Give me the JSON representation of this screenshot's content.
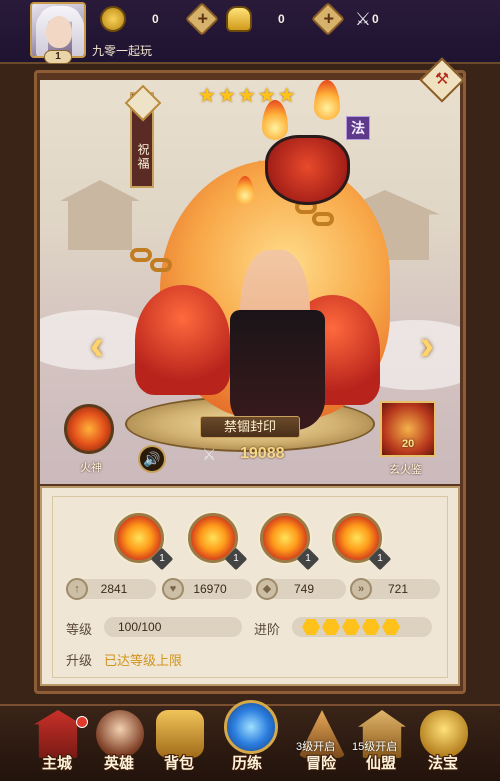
{
  "player": {
    "name": "九零一起玩",
    "level": "1"
  },
  "resources": [
    {
      "icon": "coin-icon",
      "value": "0"
    },
    {
      "icon": "gold-ingot-icon",
      "value": "0"
    },
    {
      "icon": "crossed-swords-icon",
      "value": "0"
    }
  ],
  "hero": {
    "stars": 5,
    "star_char": "★",
    "class_badge": "法",
    "bless_label": "祝福",
    "seal_label": "禁锢封印",
    "power": "19088",
    "fire_god_label": "火神",
    "artifact_label": "玄火鉴",
    "artifact_level": "20",
    "nav_prev": "‹",
    "nav_next": "›"
  },
  "skills": [
    {
      "name": "skill-1",
      "level": "1"
    },
    {
      "name": "skill-2",
      "level": "1"
    },
    {
      "name": "skill-3",
      "level": "1"
    },
    {
      "name": "skill-4",
      "level": "1"
    }
  ],
  "stats": [
    {
      "icon": "attack-icon",
      "value": "2841"
    },
    {
      "icon": "heart-icon",
      "value": "16970"
    },
    {
      "icon": "shield-icon",
      "value": "749"
    },
    {
      "icon": "speed-icon",
      "value": "721"
    }
  ],
  "level_row": {
    "label": "等级",
    "value": "100/100"
  },
  "advance_row": {
    "label": "进阶",
    "filled": 5,
    "total": 5
  },
  "upgrade_row": {
    "label": "升级",
    "status": "已达等级上限"
  },
  "nav": [
    {
      "label": "主城",
      "lock": "",
      "badge": true
    },
    {
      "label": "英雄",
      "lock": ""
    },
    {
      "label": "背包",
      "lock": ""
    },
    {
      "label": "历练",
      "lock": ""
    },
    {
      "label": "冒险",
      "lock": "3级开启"
    },
    {
      "label": "仙盟",
      "lock": "15级开启"
    },
    {
      "label": "法宝",
      "lock": ""
    }
  ],
  "colors": {
    "accent": "#ffc21a",
    "frame": "#8d5e35",
    "max_text": "#d1941e"
  }
}
